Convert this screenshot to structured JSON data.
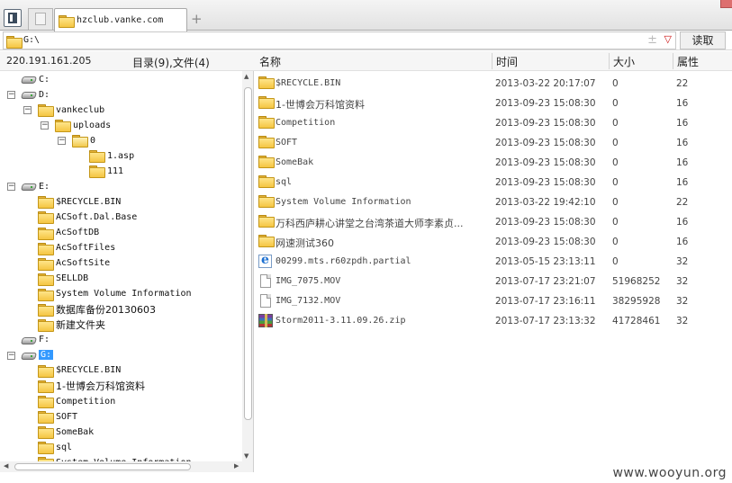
{
  "tab": {
    "title": "hzclub.vanke.com"
  },
  "address": {
    "path": "G:\\",
    "extra_glyph": "±",
    "dropdown_glyph": "▽",
    "read_button": "读取"
  },
  "info": {
    "ip": "220.191.161.205",
    "counts": "目录(9),文件(4)"
  },
  "columns": {
    "name": "名称",
    "time": "时间",
    "size": "大小",
    "attr": "属性"
  },
  "tree": [
    {
      "label": "C:",
      "icon": "drive-icon",
      "level": 0,
      "expander": ""
    },
    {
      "label": "D:",
      "icon": "drive-icon",
      "level": 0,
      "expander": "−"
    },
    {
      "label": "vankeclub",
      "icon": "folder-icon",
      "level": 1,
      "expander": "−"
    },
    {
      "label": "uploads",
      "icon": "folder-icon",
      "level": 2,
      "expander": "−"
    },
    {
      "label": "0",
      "icon": "folder-open-icon",
      "level": 3,
      "expander": "−"
    },
    {
      "label": "1.asp",
      "icon": "folder-icon",
      "level": 4,
      "expander": ""
    },
    {
      "label": "111",
      "icon": "folder-icon",
      "level": 4,
      "expander": ""
    },
    {
      "label": "E:",
      "icon": "drive-icon",
      "level": 0,
      "expander": "−"
    },
    {
      "label": "$RECYCLE.BIN",
      "icon": "folder-icon",
      "level": 1,
      "expander": ""
    },
    {
      "label": "ACSoft.Dal.Base",
      "icon": "folder-icon",
      "level": 1,
      "expander": ""
    },
    {
      "label": "AcSoftDB",
      "icon": "folder-icon",
      "level": 1,
      "expander": ""
    },
    {
      "label": "AcSoftFiles",
      "icon": "folder-icon",
      "level": 1,
      "expander": ""
    },
    {
      "label": "AcSoftSite",
      "icon": "folder-icon",
      "level": 1,
      "expander": ""
    },
    {
      "label": "SELLDB",
      "icon": "folder-icon",
      "level": 1,
      "expander": ""
    },
    {
      "label": "System Volume Information",
      "icon": "folder-icon",
      "level": 1,
      "expander": ""
    },
    {
      "label": "数据库备份20130603",
      "icon": "folder-icon",
      "level": 1,
      "expander": ""
    },
    {
      "label": "新建文件夹",
      "icon": "folder-icon",
      "level": 1,
      "expander": ""
    },
    {
      "label": "F:",
      "icon": "drive-icon",
      "level": 0,
      "expander": ""
    },
    {
      "label": "G:",
      "icon": "drive-icon",
      "level": 0,
      "expander": "−",
      "selected": true
    },
    {
      "label": "$RECYCLE.BIN",
      "icon": "folder-icon",
      "level": 1,
      "expander": ""
    },
    {
      "label": "1-世博会万科馆资料",
      "icon": "folder-icon",
      "level": 1,
      "expander": ""
    },
    {
      "label": "Competition",
      "icon": "folder-icon",
      "level": 1,
      "expander": ""
    },
    {
      "label": "SOFT",
      "icon": "folder-icon",
      "level": 1,
      "expander": ""
    },
    {
      "label": "SomeBak",
      "icon": "folder-icon",
      "level": 1,
      "expander": ""
    },
    {
      "label": "sql",
      "icon": "folder-icon",
      "level": 1,
      "expander": ""
    },
    {
      "label": "System Volume Information",
      "icon": "folder-icon",
      "level": 1,
      "expander": ""
    }
  ],
  "files": [
    {
      "name": "$RECYCLE.BIN",
      "time": "2013-03-22 20:17:07",
      "size": "0",
      "attr": "22",
      "icon": "folder-icon"
    },
    {
      "name": "1-世博会万科馆资料",
      "time": "2013-09-23 15:08:30",
      "size": "0",
      "attr": "16",
      "icon": "folder-icon"
    },
    {
      "name": "Competition",
      "time": "2013-09-23 15:08:30",
      "size": "0",
      "attr": "16",
      "icon": "folder-icon"
    },
    {
      "name": "SOFT",
      "time": "2013-09-23 15:08:30",
      "size": "0",
      "attr": "16",
      "icon": "folder-icon"
    },
    {
      "name": "SomeBak",
      "time": "2013-09-23 15:08:30",
      "size": "0",
      "attr": "16",
      "icon": "folder-icon"
    },
    {
      "name": "sql",
      "time": "2013-09-23 15:08:30",
      "size": "0",
      "attr": "16",
      "icon": "folder-icon"
    },
    {
      "name": "System Volume Information",
      "time": "2013-03-22 19:42:10",
      "size": "0",
      "attr": "22",
      "icon": "folder-icon"
    },
    {
      "name": "万科西庐耕心讲堂之台湾茶道大师李素贞...",
      "time": "2013-09-23 15:08:30",
      "size": "0",
      "attr": "16",
      "icon": "folder-icon"
    },
    {
      "name": "网速测试360",
      "time": "2013-09-23 15:08:30",
      "size": "0",
      "attr": "16",
      "icon": "folder-icon"
    },
    {
      "name": "00299.mts.r60zpdh.partial",
      "time": "2013-05-15 23:13:11",
      "size": "0",
      "attr": "32",
      "icon": "ie-file-icon"
    },
    {
      "name": "IMG_7075.MOV",
      "time": "2013-07-17 23:21:07",
      "size": "51968252",
      "attr": "32",
      "icon": "file-icon"
    },
    {
      "name": "IMG_7132.MOV",
      "time": "2013-07-17 23:16:11",
      "size": "38295928",
      "attr": "32",
      "icon": "file-icon"
    },
    {
      "name": "Storm2011-3.11.09.26.zip",
      "time": "2013-07-17 23:13:32",
      "size": "41728461",
      "attr": "32",
      "icon": "zip-icon"
    }
  ],
  "watermark": "www.wooyun.org"
}
